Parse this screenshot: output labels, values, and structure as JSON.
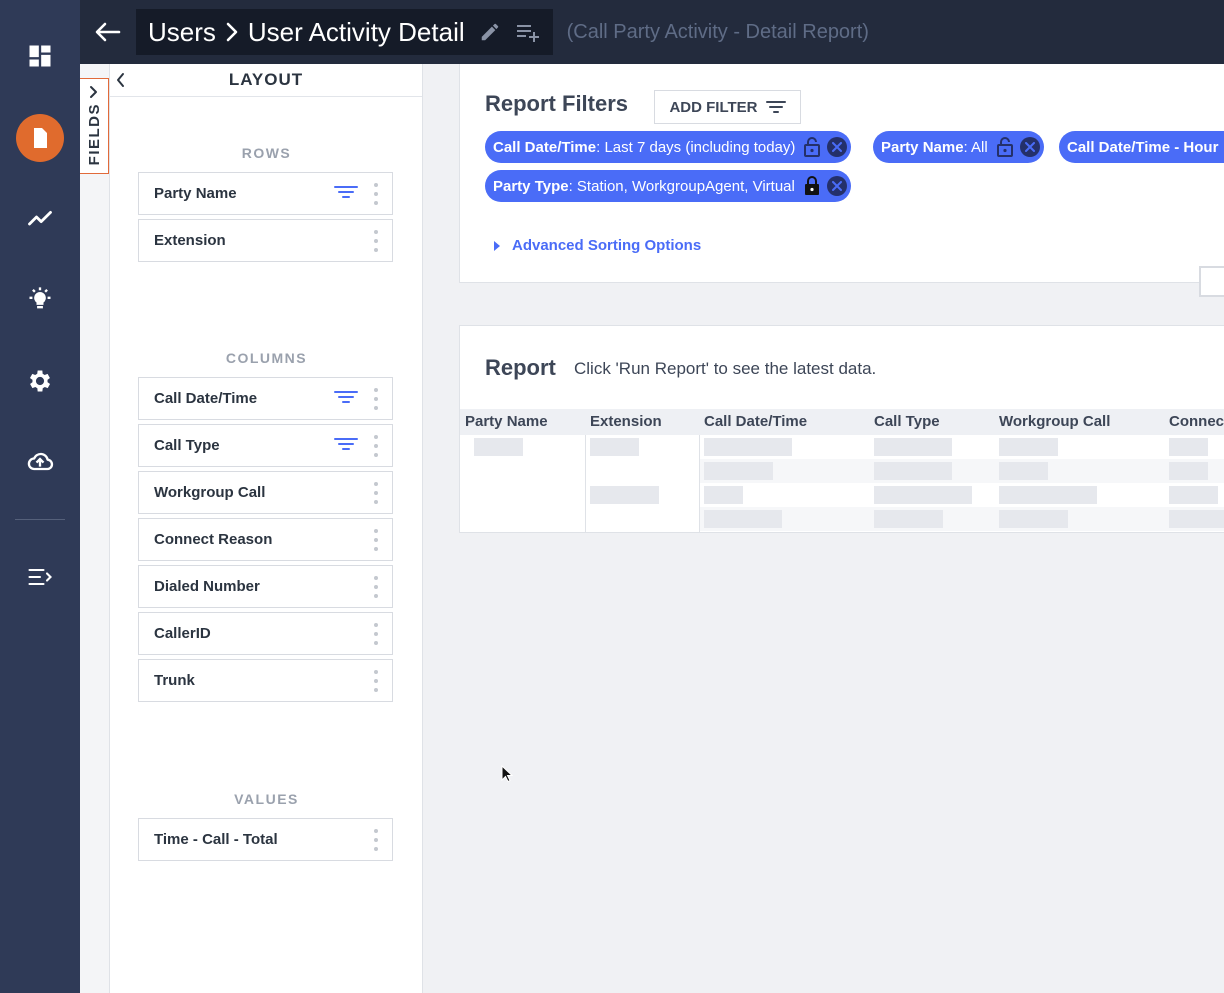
{
  "rail": {
    "items": [
      {
        "icon": "dashboard-icon"
      },
      {
        "icon": "report-document-icon",
        "active": true
      },
      {
        "icon": "trend-chart-icon"
      },
      {
        "icon": "lightbulb-icon"
      },
      {
        "icon": "gear-icon"
      },
      {
        "icon": "cloud-upload-icon"
      },
      {
        "icon": "expand-menu-icon"
      }
    ],
    "active_color": "#e06b2d"
  },
  "header": {
    "breadcrumb_parent": "Users",
    "breadcrumb_current": "User Activity Detail",
    "subtitle": "(Call Party Activity - Detail Report)"
  },
  "fields_tab": {
    "label": "FIELDS"
  },
  "layout": {
    "title": "LAYOUT",
    "rows_title": "ROWS",
    "rows": [
      {
        "label": "Party Name",
        "filtered": true
      },
      {
        "label": "Extension",
        "filtered": false
      }
    ],
    "columns_title": "COLUMNS",
    "columns": [
      {
        "label": "Call Date/Time",
        "filtered": true
      },
      {
        "label": "Call Type",
        "filtered": true
      },
      {
        "label": "Workgroup Call",
        "filtered": false
      },
      {
        "label": "Connect Reason",
        "filtered": false
      },
      {
        "label": "Dialed Number",
        "filtered": false
      },
      {
        "label": "CallerID",
        "filtered": false
      },
      {
        "label": "Trunk",
        "filtered": false
      }
    ],
    "values_title": "VALUES",
    "values": [
      {
        "label": "Time - Call - Total",
        "filtered": false
      }
    ]
  },
  "filters": {
    "title": "Report Filters",
    "add_filter_label": "ADD FILTER",
    "chips": [
      {
        "key": "Call Date/Time",
        "value": ": Last 7 days (including today)",
        "lock": "unlocked"
      },
      {
        "key": "Party Name",
        "value": ": All",
        "lock": "unlocked"
      },
      {
        "key": "Call Date/Time - Hour",
        "value": "",
        "lock": "none"
      },
      {
        "key": "Party Type",
        "value": ": Station, WorkgroupAgent, Virtual",
        "lock": "locked"
      }
    ],
    "advanced_sorting_label": "Advanced Sorting Options",
    "accent": "#4a6cf7"
  },
  "report": {
    "title": "Report",
    "hint": "Click 'Run Report' to see the latest data.",
    "columns": [
      "Party Name",
      "Extension",
      "Call Date/Time",
      "Call Type",
      "Workgroup Call",
      "Connec"
    ]
  }
}
